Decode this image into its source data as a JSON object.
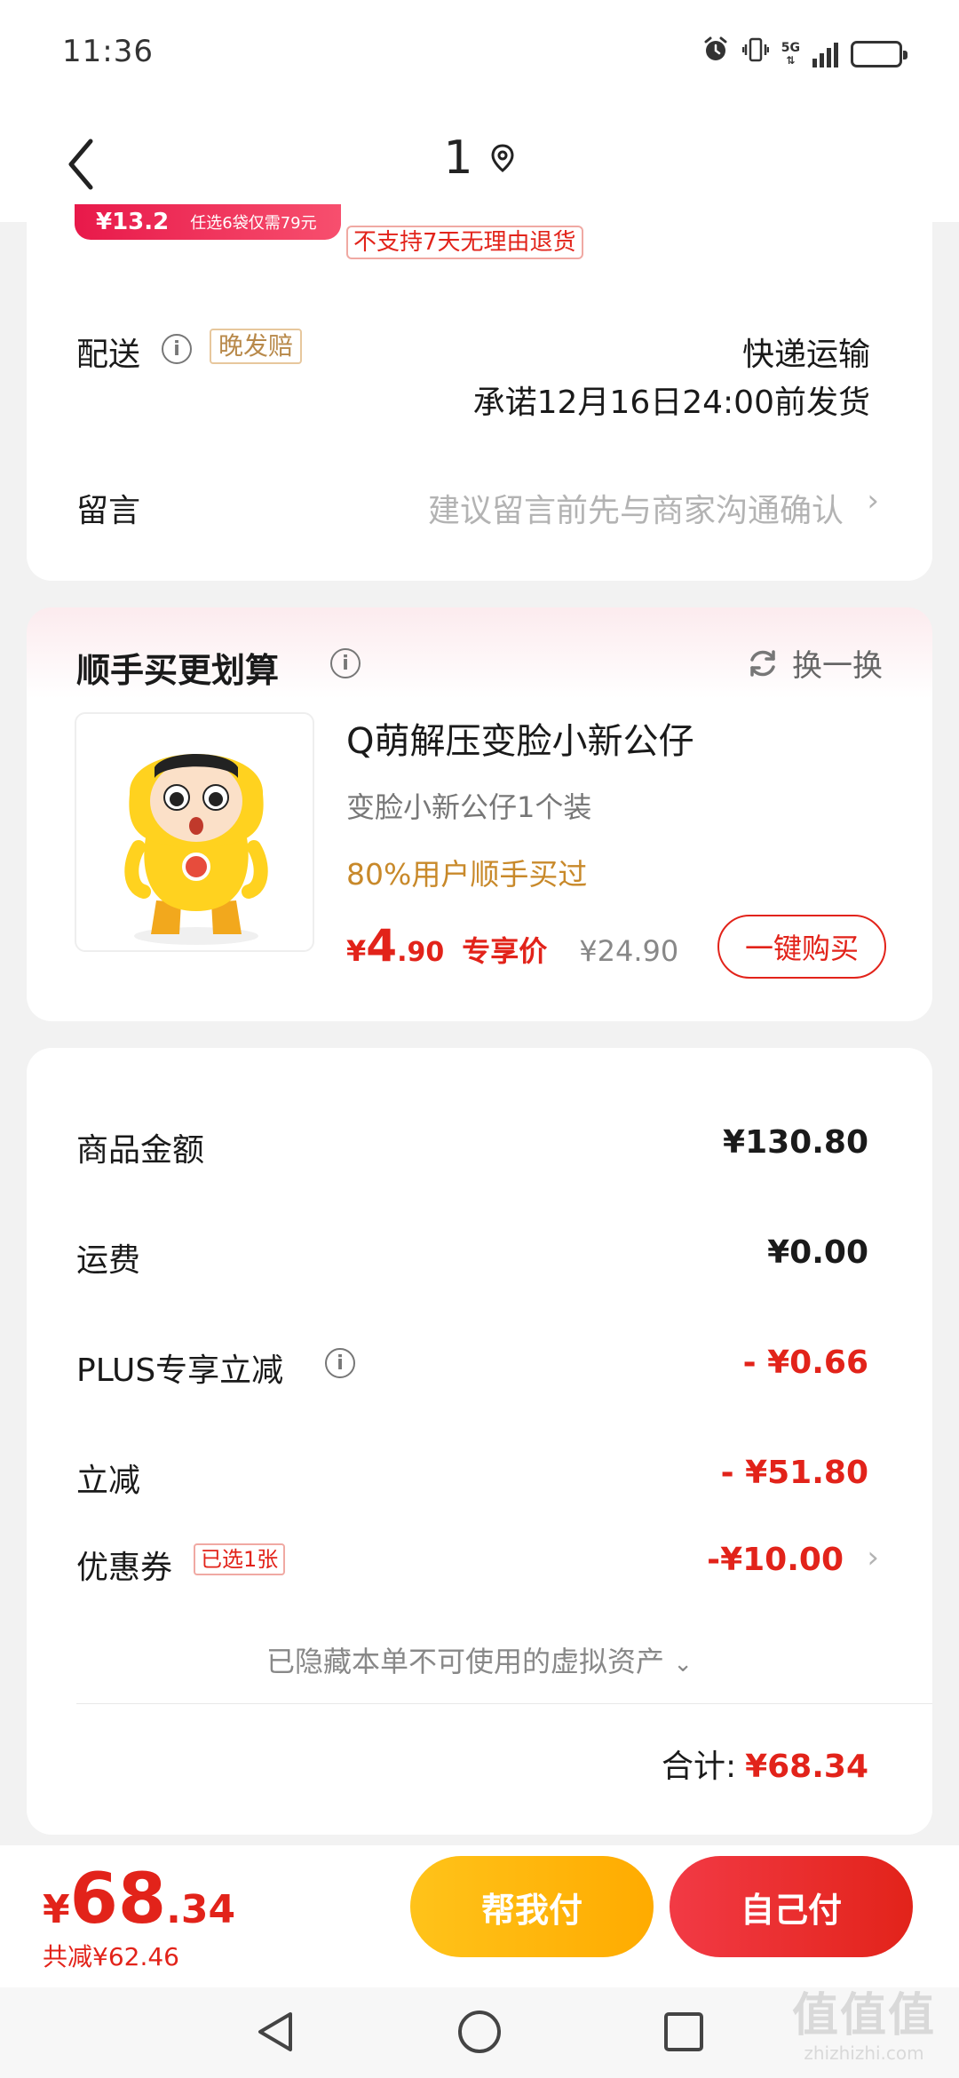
{
  "status_bar": {
    "time": "11:36",
    "network": "5G",
    "icons": [
      "alarm-icon",
      "vibrate-icon",
      "signal-icon",
      "battery-icon"
    ],
    "battery_level_fraction": 0.2
  },
  "nav": {
    "title": "1",
    "icons": [
      "back-icon",
      "location-pin-icon"
    ]
  },
  "order_card": {
    "promo_banner_price": "¥13.2",
    "promo_banner_text": "任选6袋仅需79元",
    "return_policy": "不支持7天无理由退货",
    "delivery_label": "配送",
    "late_tag": "晚发赔",
    "delivery_method": "快递运输",
    "delivery_promise": "承诺12月16日24:00前发货",
    "message_label": "留言",
    "message_placeholder": "建议留言前先与商家沟通确认"
  },
  "upsell": {
    "title": "顺手买更划算",
    "refresh_label": "换一换",
    "product": {
      "name": "Q萌解压变脸小新公仔",
      "spec": "变脸小新公仔1个装",
      "stat": "80%用户顺手买过",
      "currency": "¥",
      "price_int": "4",
      "price_dec": ".90",
      "exclusive_label": "专享价",
      "original_price": "¥24.90",
      "buy_button": "一键购买"
    }
  },
  "summary": {
    "rows": [
      {
        "label": "商品金额",
        "value": "¥130.80"
      },
      {
        "label": "运费",
        "value": "¥0.00"
      },
      {
        "label": "PLUS专享立减",
        "value": "- ¥0.66"
      },
      {
        "label": "立减",
        "value": "- ¥51.80"
      },
      {
        "label": "优惠券",
        "value": "-¥10.00"
      }
    ],
    "coupon_tag": "已选1张",
    "hidden_assets": "已隐藏本单不可使用的虚拟资产",
    "total_label": "合计:",
    "total_value": "¥68.34"
  },
  "bottom_bar": {
    "currency": "¥",
    "price_int": "68",
    "price_dec": ".34",
    "saved_text": "共减¥62.46",
    "help_pay_button": "帮我付",
    "self_pay_button": "自己付"
  },
  "watermark": {
    "main": "值值值",
    "sub": "zhizhizhi.com"
  },
  "colors": {
    "accent_red": "#e2231a",
    "gold": "#c8892a",
    "yellow_button": "#ffb800"
  }
}
